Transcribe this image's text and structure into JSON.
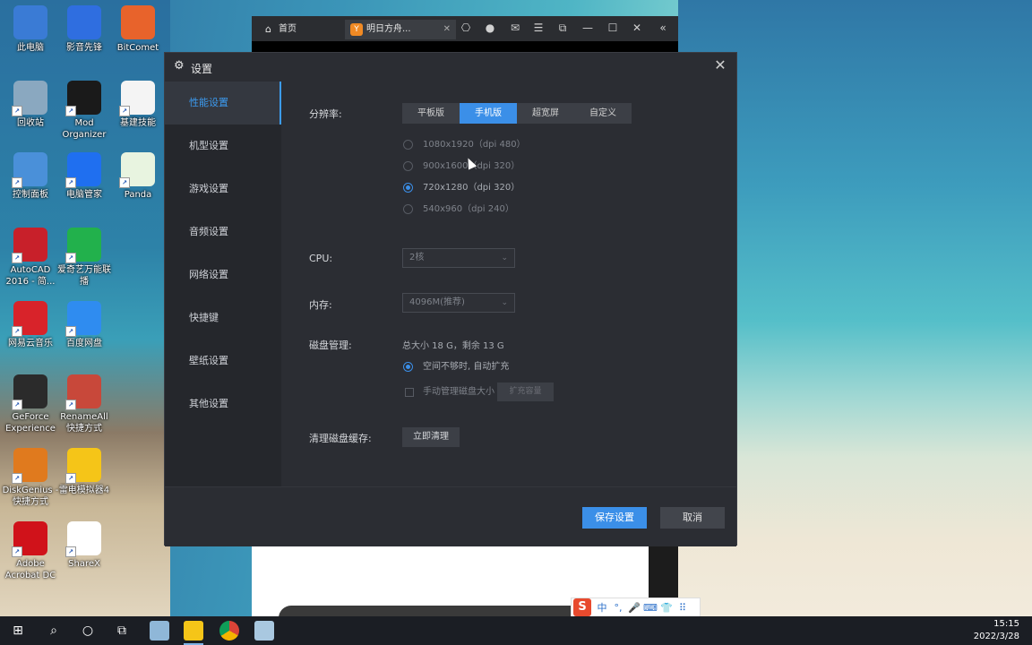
{
  "desktop_icons": [
    {
      "label": "此电脑",
      "icon": "computer-icon",
      "color": "#3a7bd5"
    },
    {
      "label": "影音先锋",
      "icon": "player-icon",
      "color": "#2f6ee0"
    },
    {
      "label": "BitComet",
      "icon": "bitcomet-icon",
      "color": "#e8632b"
    },
    {
      "label": "回收站",
      "icon": "recycle-bin-icon",
      "color": "#8aa8c0"
    },
    {
      "label": "Mod Organizer",
      "icon": "mod-organizer-icon",
      "color": "#1a1a1a"
    },
    {
      "label": "基建技能",
      "icon": "document-icon",
      "color": "#f4f4f4"
    },
    {
      "label": "控制面板",
      "icon": "control-panel-icon",
      "color": "#4a90d9"
    },
    {
      "label": "电脑管家",
      "icon": "pc-manager-icon",
      "color": "#1f6ff0"
    },
    {
      "label": "Panda",
      "icon": "panda-icon",
      "color": "#e8f4e0"
    },
    {
      "label": "AutoCAD 2016 - 简...",
      "icon": "autocad-icon",
      "color": "#c8202a"
    },
    {
      "label": "爱奇艺万能联播",
      "icon": "iqiyi-icon",
      "color": "#22b14c"
    },
    {
      "label": "网易云音乐",
      "icon": "netease-music-icon",
      "color": "#d8232a"
    },
    {
      "label": "百度网盘",
      "icon": "baidu-netdisk-icon",
      "color": "#2f8cf0"
    },
    {
      "label": "GeForce Experience",
      "icon": "nvidia-icon",
      "color": "#2b2b2b"
    },
    {
      "label": "RenameAll 快捷方式",
      "icon": "renameall-icon",
      "color": "#c8483a"
    },
    {
      "label": "DiskGenius - 快捷方式",
      "icon": "diskgenius-icon",
      "color": "#e07a1e"
    },
    {
      "label": "雷电模拟器4",
      "icon": "ldplayer-icon",
      "color": "#f5c518"
    },
    {
      "label": "Adobe Acrobat DC",
      "icon": "acrobat-icon",
      "color": "#d0121a"
    },
    {
      "label": "ShareX",
      "icon": "sharex-icon",
      "color": "#ffffff"
    }
  ],
  "emulator": {
    "tabs": [
      {
        "label": "首页",
        "icon": "home-icon"
      },
      {
        "label": "明日方舟...",
        "icon": "app-icon"
      }
    ]
  },
  "dialog": {
    "title": "设置",
    "sidebar": [
      {
        "label": "性能设置",
        "active": true
      },
      {
        "label": "机型设置",
        "active": false
      },
      {
        "label": "游戏设置",
        "active": false
      },
      {
        "label": "音频设置",
        "active": false
      },
      {
        "label": "网络设置",
        "active": false
      },
      {
        "label": "快捷键",
        "active": false
      },
      {
        "label": "壁纸设置",
        "active": false
      },
      {
        "label": "其他设置",
        "active": false
      }
    ],
    "resolution": {
      "label": "分辨率:",
      "tabs": [
        "平板版",
        "手机版",
        "超宽屏",
        "自定义"
      ],
      "selected_tab": "手机版",
      "options": [
        {
          "label": "1080x1920（dpi 480）",
          "selected": false
        },
        {
          "label": "900x1600（dpi 320）",
          "selected": false
        },
        {
          "label": "720x1280（dpi 320）",
          "selected": true
        },
        {
          "label": "540x960（dpi 240）",
          "selected": false
        }
      ]
    },
    "cpu": {
      "label": "CPU:",
      "value": "2核"
    },
    "memory": {
      "label": "内存:",
      "value": "4096M(推荐)"
    },
    "disk": {
      "label": "磁盘管理:",
      "info": "总大小 18 G，剩余 13 G",
      "auto_label": "空间不够时, 自动扩充",
      "manual_label": "手动管理磁盘大小",
      "expand_button": "扩充容量"
    },
    "clean": {
      "label": "清理磁盘缓存:",
      "button": "立即清理"
    },
    "save_button": "保存设置",
    "cancel_button": "取消"
  },
  "ime": {
    "logo": "S",
    "items": [
      "中",
      "°,",
      "mic",
      "kbd",
      "shirt",
      "grid"
    ]
  },
  "taskbar": {
    "time": "15:15",
    "date": "2022/3/28"
  },
  "colors": {
    "accent": "#3b8fe8",
    "dialog_bg": "#2b2d33",
    "sidebar_bg": "#25272c",
    "taskbar_bg": "#1b1e24"
  }
}
